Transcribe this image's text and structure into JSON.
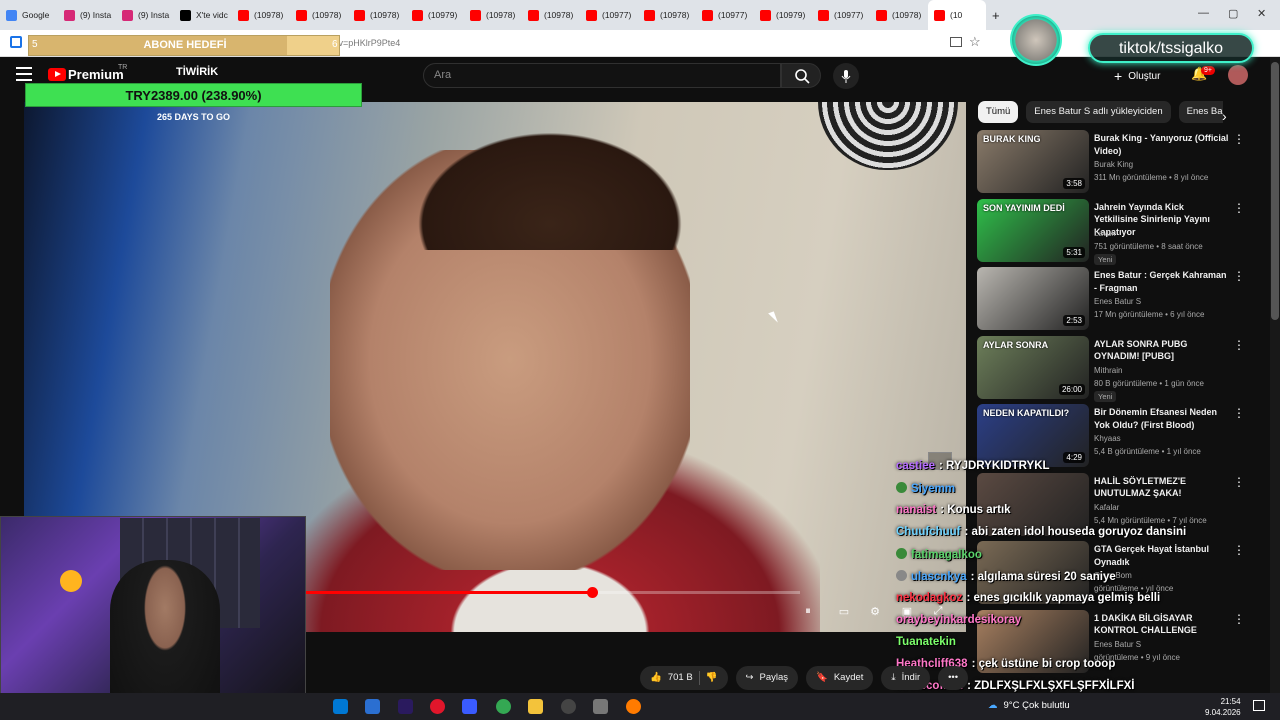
{
  "browser": {
    "tabs": [
      {
        "label": "Google",
        "color": "#4285f4"
      },
      {
        "label": "(9) Insta",
        "color": "#d62976"
      },
      {
        "label": "(9) Insta",
        "color": "#d62976"
      },
      {
        "label": "X'te vidc",
        "color": "#000000"
      },
      {
        "label": "(10978)",
        "color": "#ff0000"
      },
      {
        "label": "(10978)",
        "color": "#ff0000"
      },
      {
        "label": "(10978)",
        "color": "#ff0000"
      },
      {
        "label": "(10979)",
        "color": "#ff0000"
      },
      {
        "label": "(10978)",
        "color": "#ff0000"
      },
      {
        "label": "(10978)",
        "color": "#ff0000"
      },
      {
        "label": "(10977)",
        "color": "#ff0000"
      },
      {
        "label": "(10978)",
        "color": "#ff0000"
      },
      {
        "label": "(10977)",
        "color": "#ff0000"
      },
      {
        "label": "(10979)",
        "color": "#ff0000"
      },
      {
        "label": "(10977)",
        "color": "#ff0000"
      },
      {
        "label": "(10978)",
        "color": "#ff0000"
      },
      {
        "label": "(10",
        "color": "#ff0000"
      }
    ],
    "new_tab": "+",
    "url": ".com/watch?v=pHKlrP9Pte4"
  },
  "overlay": {
    "abone_title": "ABONE HEDEFİ",
    "abone_left": "5",
    "abone_right": "6",
    "donation": "TRY2389.00 (238.90%)",
    "days": "265 DAYS TO GO",
    "tiktok": "tiktok/tssigalko"
  },
  "youtube": {
    "brand": "Premium",
    "region": "TR",
    "channel_overlay": "TİWİRİK",
    "search_placeholder": "Ara",
    "create": "Oluştur",
    "notif_badge": "9+",
    "chips": [
      "Tümü",
      "Enes Batur S adlı yükleyiciden",
      "Enes Ba"
    ],
    "recommendations": [
      {
        "title": "Burak King - Yanıyoruz (Official Video)",
        "channel": "Burak King",
        "meta": "311 Mn görüntüleme • 8 yıl önce",
        "duration": "3:58",
        "thumb_text": "BURAK KING",
        "badge": "",
        "thumb_color": "#8a7b6a"
      },
      {
        "title": "Jahrein Yayında Kick Yetkilisine Sinirlenip Yayını Kapatıyor",
        "channel": "Lavuk",
        "meta": "751 görüntüleme • 8 saat önce",
        "duration": "5:31",
        "thumb_text": "SON YAYINIM DEDİ",
        "badge": "Yeni",
        "thumb_color": "#2fc04a"
      },
      {
        "title": "Enes Batur : Gerçek Kahraman - Fragman",
        "channel": "Enes Batur S",
        "meta": "17 Mn görüntüleme • 6 yıl önce",
        "duration": "2:53",
        "thumb_text": "",
        "badge": "",
        "thumb_color": "#b9b6b0"
      },
      {
        "title": "AYLAR SONRA PUBG OYNADIM! [PUBG]",
        "channel": "Mithrain",
        "meta": "80 B görüntüleme • 1 gün önce",
        "duration": "26:00",
        "thumb_text": "AYLAR SONRA",
        "badge": "Yeni",
        "thumb_color": "#6d7f5a"
      },
      {
        "title": "Bir Dönemin Efsanesi Neden Yok Oldu? (First Blood)",
        "channel": "Khyaas",
        "meta": "5,4 B görüntüleme • 1 yıl önce",
        "duration": "4:29",
        "thumb_text": "NEDEN KAPATILDI?",
        "badge": "",
        "thumb_color": "#2b3f88"
      },
      {
        "title": "HALİL SÖYLETMEZ'E UNUTULMAZ ŞAKA!",
        "channel": "Kafalar",
        "meta": "5,4 Mn görüntüleme • 7 yıl önce",
        "duration": "",
        "thumb_text": "",
        "badge": "",
        "thumb_color": "#5b4a42"
      },
      {
        "title": "GTA Gerçek Hayat İstanbul Oynadık",
        "channel": "Oyun Bom",
        "meta": "görüntüleme • yıl önce",
        "duration": "",
        "thumb_text": "",
        "badge": "",
        "thumb_color": "#7a6a55"
      },
      {
        "title": "1 DAKİKA BİLGİSAYAR KONTROL CHALLENGE",
        "channel": "Enes Batur S",
        "meta": "görüntüleme • 9 yıl önce",
        "duration": "",
        "thumb_text": "",
        "badge": "",
        "thumb_color": "#a88060"
      }
    ],
    "actions": {
      "like": "701 B",
      "share": "Paylaş",
      "save": "Kaydet",
      "download": "İndir",
      "more": "•••"
    },
    "progress_fraction": 0.58
  },
  "chat": [
    {
      "user": "castiee",
      "msg": "RYJDRYKIDTRYKL",
      "color": "#b56cff",
      "icon": ""
    },
    {
      "user": "Siyemm",
      "msg": "",
      "color": "#4aa8ff",
      "icon": "#3a8a3a"
    },
    {
      "user": "nanaist",
      "msg": "Konus artık",
      "color": "#ff77c8",
      "icon": ""
    },
    {
      "user": "Chuufchuuf",
      "msg": "abi zaten idol houseda goruyoz dansini",
      "color": "#6fd3ff",
      "icon": ""
    },
    {
      "user": "fatimagalkoo",
      "msg": "",
      "color": "#5bd36b",
      "icon": "#3a8a3a"
    },
    {
      "user": "ulascnkya",
      "msg": "algılama süresi 20 saniye",
      "color": "#4aa8ff",
      "icon": "#888888"
    },
    {
      "user": "nekodagkoz",
      "msg": "enes gıcıklık yapmaya gelmiş belli",
      "color": "#ff3344",
      "icon": ""
    },
    {
      "user": "oraybeyinkardesikoray",
      "msg": "",
      "color": "#ff77c8",
      "icon": ""
    },
    {
      "user": "Tuanatekin",
      "msg": "",
      "color": "#7cff6b",
      "icon": ""
    },
    {
      "user": "Heathcliff638",
      "msg": "çek üstüne bi crop tooop",
      "color": "#ff77c8",
      "icon": ""
    },
    {
      "user": "fenascofield",
      "msg": "ZDLFXŞLFXLŞXFLŞFFXİLFXİ",
      "color": "#ff77c8",
      "icon": ""
    }
  ],
  "taskbar": {
    "weather": "9°C Çok bulutlu",
    "time": "21:54",
    "date": "9.04.2026"
  }
}
